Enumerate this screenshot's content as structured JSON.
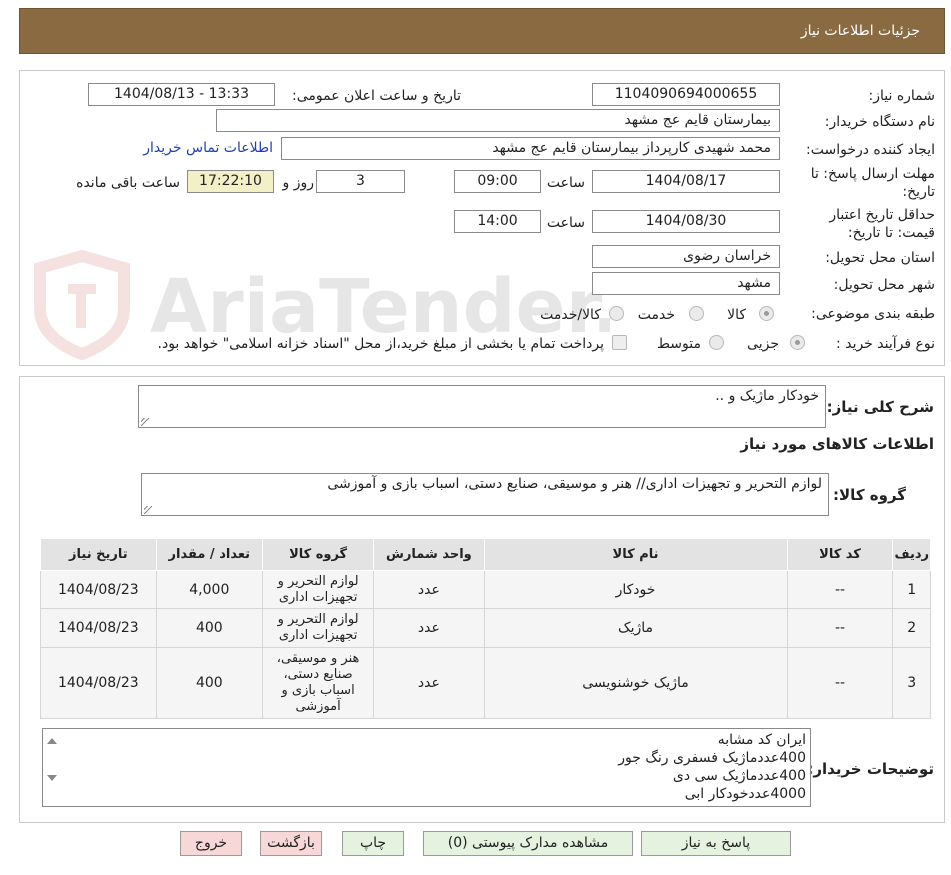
{
  "header": {
    "title": "جزئیات اطلاعات نیاز"
  },
  "watermark": {
    "text": "AriaTender.neT"
  },
  "form": {
    "need_number_label": "شماره نیاز:",
    "need_number": "1104090694000655",
    "announce_label": "تاریخ و ساعت اعلان عمومی:",
    "announce_value": "1404/08/13 - 13:33",
    "buyer_org_label": "نام دستگاه خریدار:",
    "buyer_org": "بیمارستان قایم  عج  مشهد",
    "creator_label": "ایجاد کننده درخواست:",
    "creator": "محمد شهیدی کارپرداز بیمارستان قایم  عج  مشهد",
    "contact_link": "اطلاعات تماس خریدار",
    "deadline_label_1": "مهلت ارسال پاسخ: تا",
    "deadline_label_2": "تاریخ:",
    "deadline_date": "1404/08/17",
    "hour_label": "ساعت",
    "deadline_time": "09:00",
    "days_value": "3",
    "days_label": "روز و",
    "remaining_time": "17:22:10",
    "remaining_label": "ساعت باقی مانده",
    "validity_label_1": "حداقل تاریخ اعتبار",
    "validity_label_2": "قیمت: تا تاریخ:",
    "validity_date": "1404/08/30",
    "validity_hour_label": "ساعت",
    "validity_time": "14:00",
    "province_label": "استان محل تحویل:",
    "province": "خراسان رضوی",
    "city_label": "شهر محل تحویل:",
    "city": "مشهد",
    "category_label": "طبقه بندی موضوعی:",
    "category_options": [
      "کالا",
      "خدمت",
      "کالا/خدمت"
    ],
    "category_selected": "کالا",
    "process_label": "نوع فرآیند خرید :",
    "process_options": [
      "جزیی",
      "متوسط"
    ],
    "process_selected": "جزیی",
    "payment_note": "پرداخت تمام یا بخشی از مبلغ خرید،از محل \"اسناد خزانه اسلامی\" خواهد بود."
  },
  "summary": {
    "label": "شرح کلی نیاز:",
    "value": "خودکار ماژیک و ..",
    "items_title": "اطلاعات کالاهای مورد نیاز",
    "group_label": "گروه کالا:",
    "group_value": "لوازم التحریر و تجهیزات اداری// هنر و موسیقی، صنایع دستی، اسباب بازی و آموزشی"
  },
  "table": {
    "headers": [
      "ردیف",
      "کد کالا",
      "نام کالا",
      "واحد شمارش",
      "گروه کالا",
      "تعداد / مقدار",
      "تاریخ نیاز"
    ],
    "rows": [
      {
        "index": "1",
        "code": "--",
        "name": "خودکار",
        "unit": "عدد",
        "group": "لوازم التحریر و تجهیزات اداری",
        "qty": "4,000",
        "date": "1404/08/23"
      },
      {
        "index": "2",
        "code": "--",
        "name": "ماژیک",
        "unit": "عدد",
        "group": "لوازم التحریر و تجهیزات اداری",
        "qty": "400",
        "date": "1404/08/23"
      },
      {
        "index": "3",
        "code": "--",
        "name": "ماژیک خوشنویسی",
        "unit": "عدد",
        "group": "هنر و موسیقی، صنایع دستی، اسباب بازی و آموزشی",
        "qty": "400",
        "date": "1404/08/23"
      }
    ]
  },
  "notes": {
    "label": "توضیحات خریدار:",
    "lines": [
      "ایران کد مشابه",
      "400عددماژیک فسفری رنگ جور",
      "400عددماژیک سی دی",
      "4000عددخودکار ابی"
    ]
  },
  "buttons": {
    "reply": "پاسخ به نیاز",
    "attachments": "مشاهده مدارک پیوستی (0)",
    "print": "چاپ",
    "back": "بازگشت",
    "exit": "خروج"
  }
}
